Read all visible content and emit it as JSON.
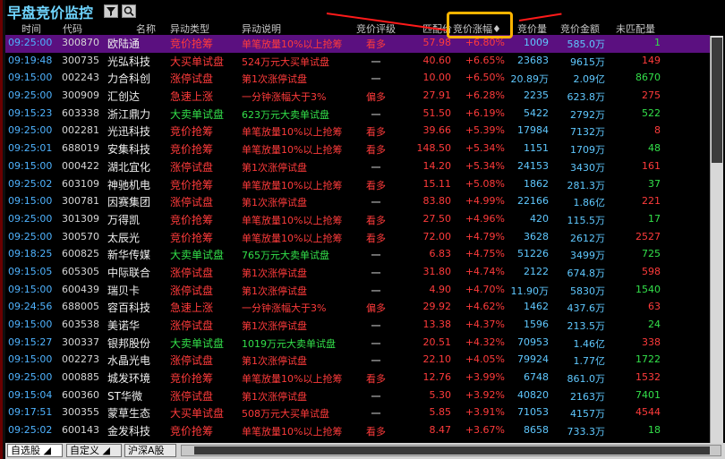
{
  "window": {
    "title": "早盘竞价监控"
  },
  "toolbar": {
    "filter_icon": "filter-icon",
    "search_icon": "search-icon"
  },
  "columns": {
    "time": "时间",
    "code": "代码",
    "name": "名称",
    "type": "异动类型",
    "desc": "异动说明",
    "rating": "竞价评级",
    "price": "匹配价",
    "change": "竞价涨幅♦",
    "volume": "竞价量",
    "amount": "竞价金额",
    "unmatched": "未匹配量"
  },
  "colors": {
    "red": "#ff3b3b",
    "green": "#33e04a",
    "blue": "#4fb3ff",
    "yellow": "#ffd200",
    "highlight": "#ffb400"
  },
  "rows": [
    {
      "time": "09:25:00",
      "code": "300870",
      "name": "欧陆通",
      "type": "竞价抢筹",
      "type_color": "red",
      "desc": "单笔放量10%以上抢筹",
      "desc_color": "red",
      "rating": "看多",
      "price": "57.98",
      "chg": "+6.80%",
      "vol": "1009",
      "amt": "585.0万",
      "unm": "1",
      "selected": true
    },
    {
      "time": "09:19:48",
      "code": "300735",
      "name": "光弘科技",
      "type": "大买单试盘",
      "type_color": "red",
      "desc": "524万元大买单试盘",
      "desc_color": "red",
      "rating": "一",
      "price": "40.60",
      "chg": "+6.65%",
      "vol": "23683",
      "amt": "9615万",
      "unm": "149"
    },
    {
      "time": "09:15:00",
      "code": "002243",
      "name": "力合科创",
      "type": "涨停试盘",
      "type_color": "red",
      "desc": "第1次涨停试盘",
      "desc_color": "red",
      "rating": "一",
      "price": "10.00",
      "chg": "+6.50%",
      "vol": "20.89万",
      "amt": "2.09亿",
      "unm": "8670"
    },
    {
      "time": "09:25:00",
      "code": "300909",
      "name": "汇创达",
      "type": "急速上涨",
      "type_color": "red",
      "desc": "一分钟涨幅大于3%",
      "desc_color": "red",
      "rating": "偏多",
      "price": "27.91",
      "chg": "+6.28%",
      "vol": "2235",
      "amt": "623.8万",
      "unm": "275"
    },
    {
      "time": "09:15:23",
      "code": "603338",
      "name": "浙江鼎力",
      "type": "大卖单试盘",
      "type_color": "green",
      "desc": "623万元大卖单试盘",
      "desc_color": "green",
      "rating": "一",
      "price": "51.50",
      "chg": "+6.19%",
      "vol": "5422",
      "amt": "2792万",
      "unm": "522"
    },
    {
      "time": "09:25:00",
      "code": "002281",
      "name": "光迅科技",
      "type": "竞价抢筹",
      "type_color": "red",
      "desc": "单笔放量10%以上抢筹",
      "desc_color": "red",
      "rating": "看多",
      "price": "39.66",
      "chg": "+5.39%",
      "vol": "17984",
      "amt": "7132万",
      "unm": "8"
    },
    {
      "time": "09:25:01",
      "code": "688019",
      "name": "安集科技",
      "type": "竞价抢筹",
      "type_color": "red",
      "desc": "单笔放量10%以上抢筹",
      "desc_color": "red",
      "rating": "看多",
      "price": "148.50",
      "chg": "+5.34%",
      "vol": "1151",
      "amt": "1709万",
      "unm": "48"
    },
    {
      "time": "09:15:00",
      "code": "000422",
      "name": "湖北宜化",
      "type": "涨停试盘",
      "type_color": "red",
      "desc": "第1次涨停试盘",
      "desc_color": "red",
      "rating": "一",
      "price": "14.20",
      "chg": "+5.34%",
      "vol": "24153",
      "amt": "3430万",
      "unm": "161"
    },
    {
      "time": "09:25:02",
      "code": "603109",
      "name": "神驰机电",
      "type": "竞价抢筹",
      "type_color": "red",
      "desc": "单笔放量10%以上抢筹",
      "desc_color": "red",
      "rating": "看多",
      "price": "15.11",
      "chg": "+5.08%",
      "vol": "1862",
      "amt": "281.3万",
      "unm": "37"
    },
    {
      "time": "09:15:00",
      "code": "300781",
      "name": "因赛集团",
      "type": "涨停试盘",
      "type_color": "red",
      "desc": "第1次涨停试盘",
      "desc_color": "red",
      "rating": "一",
      "price": "83.80",
      "chg": "+4.99%",
      "vol": "22166",
      "amt": "1.86亿",
      "unm": "221"
    },
    {
      "time": "09:25:00",
      "code": "301309",
      "name": "万得凯",
      "type": "竞价抢筹",
      "type_color": "red",
      "desc": "单笔放量10%以上抢筹",
      "desc_color": "red",
      "rating": "看多",
      "price": "27.50",
      "chg": "+4.96%",
      "vol": "420",
      "amt": "115.5万",
      "unm": "17"
    },
    {
      "time": "09:25:00",
      "code": "300570",
      "name": "太辰光",
      "type": "竞价抢筹",
      "type_color": "red",
      "desc": "单笔放量10%以上抢筹",
      "desc_color": "red",
      "rating": "看多",
      "price": "72.00",
      "chg": "+4.79%",
      "vol": "3628",
      "amt": "2612万",
      "unm": "2527"
    },
    {
      "time": "09:18:25",
      "code": "600825",
      "name": "新华传媒",
      "type": "大卖单试盘",
      "type_color": "green",
      "desc": "765万元大卖单试盘",
      "desc_color": "green",
      "rating": "一",
      "price": "6.83",
      "chg": "+4.75%",
      "vol": "51226",
      "amt": "3499万",
      "unm": "725"
    },
    {
      "time": "09:15:05",
      "code": "605305",
      "name": "中际联合",
      "type": "涨停试盘",
      "type_color": "red",
      "desc": "第1次涨停试盘",
      "desc_color": "red",
      "rating": "一",
      "price": "31.80",
      "chg": "+4.74%",
      "vol": "2122",
      "amt": "674.8万",
      "unm": "598"
    },
    {
      "time": "09:15:00",
      "code": "600439",
      "name": "瑞贝卡",
      "type": "涨停试盘",
      "type_color": "red",
      "desc": "第1次涨停试盘",
      "desc_color": "red",
      "rating": "一",
      "price": "4.90",
      "chg": "+4.70%",
      "vol": "11.90万",
      "amt": "5830万",
      "unm": "1540"
    },
    {
      "time": "09:24:56",
      "code": "688005",
      "name": "容百科技",
      "type": "急速上涨",
      "type_color": "red",
      "desc": "一分钟涨幅大于3%",
      "desc_color": "red",
      "rating": "偏多",
      "price": "29.92",
      "chg": "+4.62%",
      "vol": "1462",
      "amt": "437.6万",
      "unm": "63"
    },
    {
      "time": "09:15:00",
      "code": "603538",
      "name": "美诺华",
      "type": "涨停试盘",
      "type_color": "red",
      "desc": "第1次涨停试盘",
      "desc_color": "red",
      "rating": "一",
      "price": "13.38",
      "chg": "+4.37%",
      "vol": "1596",
      "amt": "213.5万",
      "unm": "24"
    },
    {
      "time": "09:15:27",
      "code": "300337",
      "name": "银邦股份",
      "type": "大卖单试盘",
      "type_color": "green",
      "desc": "1019万元大卖单试盘",
      "desc_color": "green",
      "rating": "一",
      "price": "20.51",
      "chg": "+4.32%",
      "vol": "70953",
      "amt": "1.46亿",
      "unm": "338"
    },
    {
      "time": "09:15:00",
      "code": "002273",
      "name": "水晶光电",
      "type": "涨停试盘",
      "type_color": "red",
      "desc": "第1次涨停试盘",
      "desc_color": "red",
      "rating": "一",
      "price": "22.10",
      "chg": "+4.05%",
      "vol": "79924",
      "amt": "1.77亿",
      "unm": "1722"
    },
    {
      "time": "09:25:00",
      "code": "000885",
      "name": "城发环境",
      "type": "竞价抢筹",
      "type_color": "red",
      "desc": "单笔放量10%以上抢筹",
      "desc_color": "red",
      "rating": "看多",
      "price": "12.76",
      "chg": "+3.99%",
      "vol": "6748",
      "amt": "861.0万",
      "unm": "1532"
    },
    {
      "time": "09:15:04",
      "code": "600360",
      "name": "ST华微",
      "type": "涨停试盘",
      "type_color": "red",
      "desc": "第1次涨停试盘",
      "desc_color": "red",
      "rating": "一",
      "price": "5.30",
      "chg": "+3.92%",
      "vol": "40820",
      "amt": "2163万",
      "unm": "7401"
    },
    {
      "time": "09:17:51",
      "code": "300355",
      "name": "蒙草生态",
      "type": "大买单试盘",
      "type_color": "red",
      "desc": "508万元大买单试盘",
      "desc_color": "red",
      "rating": "一",
      "price": "5.85",
      "chg": "+3.91%",
      "vol": "71053",
      "amt": "4157万",
      "unm": "4544"
    },
    {
      "time": "09:25:02",
      "code": "600143",
      "name": "金发科技",
      "type": "竞价抢筹",
      "type_color": "red",
      "desc": "单笔放量10%以上抢筹",
      "desc_color": "red",
      "rating": "看多",
      "price": "8.47",
      "chg": "+3.67%",
      "vol": "8658",
      "amt": "733.3万",
      "unm": "18"
    }
  ],
  "bottom_tabs": [
    "自选股 ◢",
    "自定义 ◢",
    "沪深A股"
  ]
}
